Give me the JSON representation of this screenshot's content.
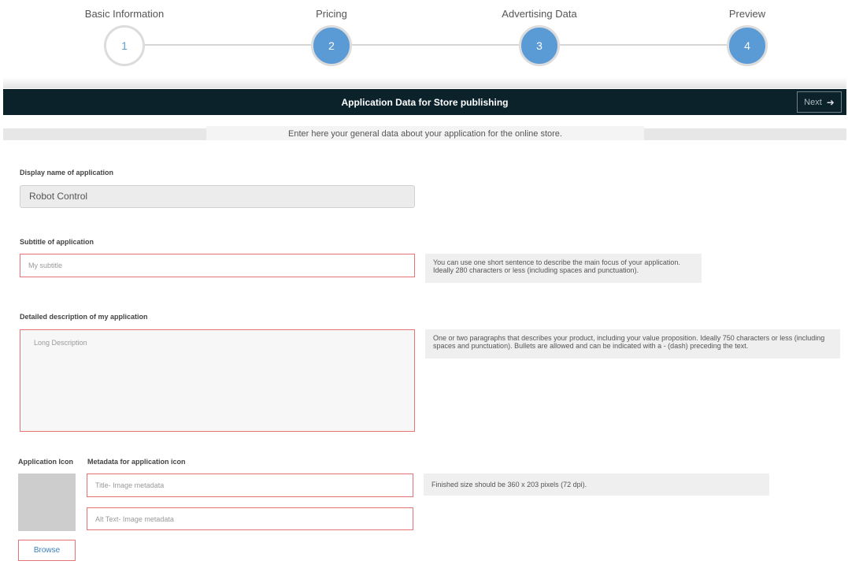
{
  "stepper": {
    "steps": [
      {
        "label": "Basic Information",
        "number": "1",
        "state": "inactive"
      },
      {
        "label": "Pricing",
        "number": "2",
        "state": "active"
      },
      {
        "label": "Advertising Data",
        "number": "3",
        "state": "active"
      },
      {
        "label": "Preview",
        "number": "4",
        "state": "active"
      }
    ]
  },
  "header": {
    "title": "Application Data for Store publishing",
    "next_label": "Next",
    "next_icon": "arrow-right-icon"
  },
  "intro": "Enter here your general data about your application for the online store.",
  "form": {
    "display_name": {
      "label": "Display name of application",
      "value": "Robot Control"
    },
    "subtitle": {
      "label": "Subtitle of application",
      "placeholder": "My subtitle",
      "hint": "You can use one short sentence to describe the main focus of your application. Ideally 280 characters or less (including spaces and punctuation)."
    },
    "description": {
      "label": "Detailed description of my application",
      "placeholder": "Long Description",
      "hint": "One or two paragraphs that describes your product, including your value proposition. Ideally 750 characters or less (including spaces and punctuation). Bullets are allowed and can be indicated with a - (dash) preceding the text."
    },
    "icon": {
      "label": "Application Icon",
      "metadata_label": "Metadata for application icon",
      "title_placeholder": "Title- Image metadata",
      "alt_placeholder": "Alt Text- Image metadata",
      "hint": "Finished size should be 360 x 203 pixels (72 dpi).",
      "browse_label": "Browse"
    }
  },
  "colors": {
    "header_bg": "#0b222b",
    "step_active": "#5b9bd5",
    "error_border": "#e57373"
  }
}
